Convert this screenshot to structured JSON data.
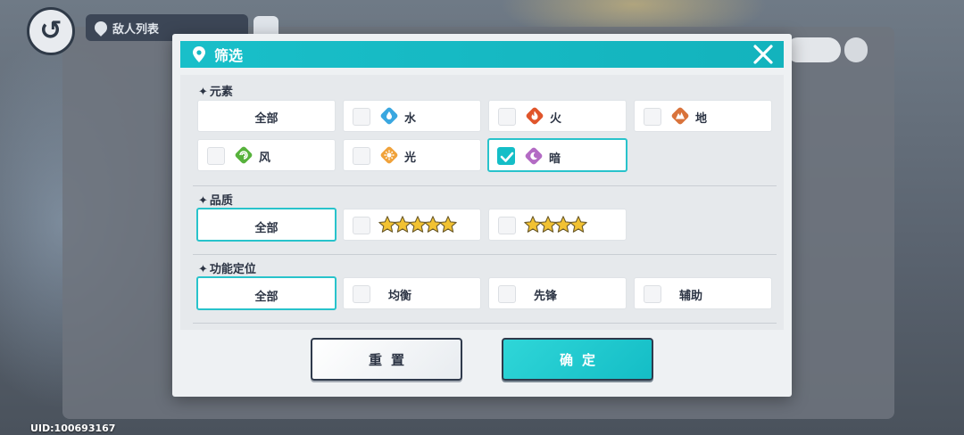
{
  "background": {
    "title_bar_text": "敌人列表"
  },
  "uid": "UID:100693167",
  "dialog": {
    "title": "筛选",
    "icons": {
      "header": "location-pin-icon",
      "close": "close-x-icon"
    },
    "sections": {
      "element": {
        "label": "元素",
        "options": {
          "all": "全部",
          "water": "水",
          "fire": "火",
          "earth": "地",
          "wind": "风",
          "light": "光",
          "dark": "暗"
        },
        "selected": "dark"
      },
      "quality": {
        "label": "品质",
        "options": {
          "all": "全部",
          "five_star": 5,
          "four_star": 4
        },
        "selected": "all"
      },
      "role": {
        "label": "功能定位",
        "options": {
          "all": "全部",
          "balance": "均衡",
          "vanguard": "先锋",
          "support": "辅助"
        },
        "selected": "all"
      }
    },
    "buttons": {
      "reset": "重置",
      "confirm": "确定"
    },
    "colors": {
      "accent": "#14bec7",
      "water": "#3aa7e0",
      "fire": "#e0552b",
      "earth": "#d9733b",
      "wind": "#57b23c",
      "light": "#f0a23a",
      "dark": "#b36bc4",
      "star": "#f2c232"
    }
  }
}
